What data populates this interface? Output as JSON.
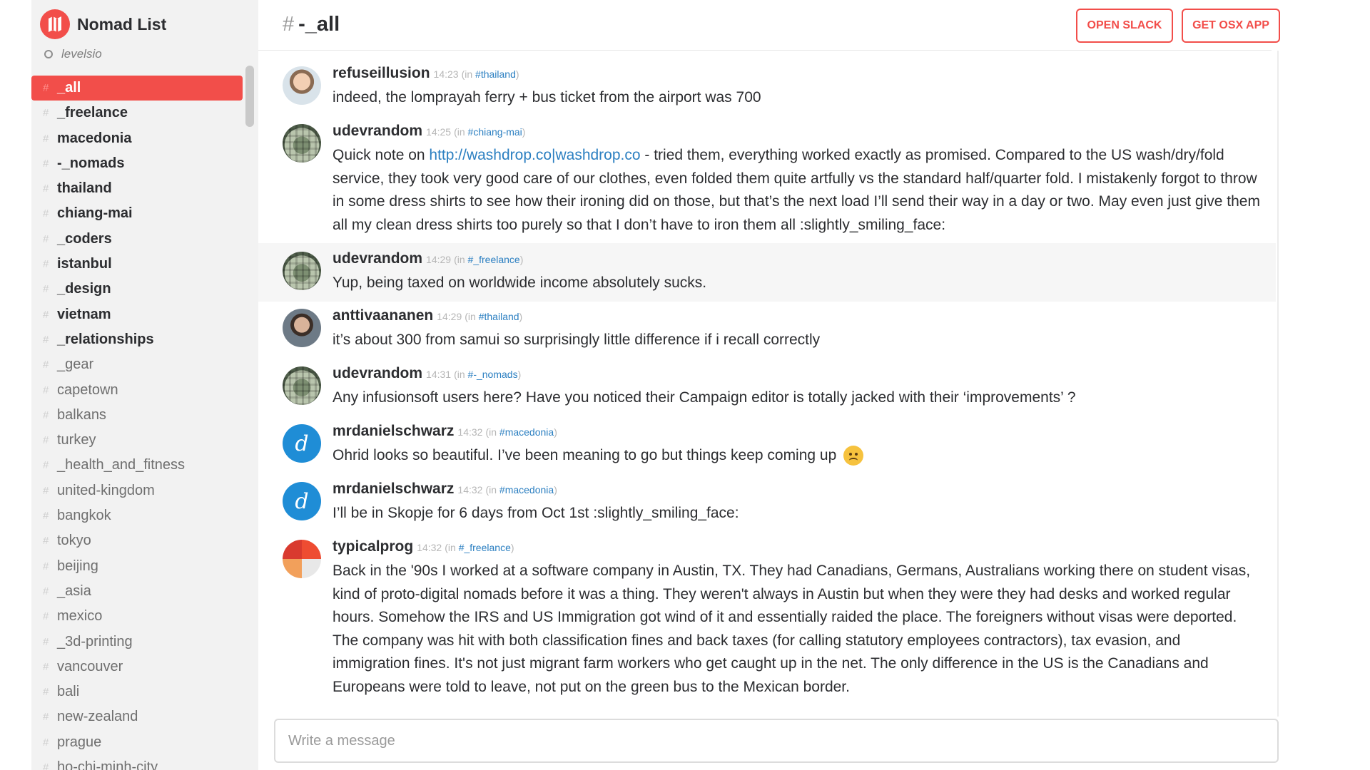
{
  "team": {
    "name": "Nomad List"
  },
  "user": {
    "name": "levelsio"
  },
  "channels": [
    {
      "label": "_all",
      "state": "active"
    },
    {
      "label": "_freelance",
      "state": "bold"
    },
    {
      "label": "macedonia",
      "state": "bold"
    },
    {
      "label": "-_nomads",
      "state": "bold"
    },
    {
      "label": "thailand",
      "state": "bold"
    },
    {
      "label": "chiang-mai",
      "state": "bold"
    },
    {
      "label": "_coders",
      "state": "bold"
    },
    {
      "label": "istanbul",
      "state": "bold"
    },
    {
      "label": "_design",
      "state": "bold"
    },
    {
      "label": "vietnam",
      "state": "bold"
    },
    {
      "label": "_relationships",
      "state": "bold"
    },
    {
      "label": "_gear",
      "state": "muted"
    },
    {
      "label": "capetown",
      "state": "muted"
    },
    {
      "label": "balkans",
      "state": "muted"
    },
    {
      "label": "turkey",
      "state": "muted"
    },
    {
      "label": "_health_and_fitness",
      "state": "muted"
    },
    {
      "label": "united-kingdom",
      "state": "muted"
    },
    {
      "label": "bangkok",
      "state": "muted"
    },
    {
      "label": "tokyo",
      "state": "muted"
    },
    {
      "label": "beijing",
      "state": "muted"
    },
    {
      "label": "_asia",
      "state": "muted"
    },
    {
      "label": "mexico",
      "state": "muted"
    },
    {
      "label": "_3d-printing",
      "state": "muted"
    },
    {
      "label": "vancouver",
      "state": "muted"
    },
    {
      "label": "bali",
      "state": "muted"
    },
    {
      "label": "new-zealand",
      "state": "muted"
    },
    {
      "label": "prague",
      "state": "muted"
    },
    {
      "label": "ho-chi-minh-city",
      "state": "muted"
    }
  ],
  "header": {
    "hash": "#",
    "channel": "-_all",
    "open_slack": "OPEN SLACK",
    "get_osx": "GET OSX APP"
  },
  "messages": [
    {
      "user": "refuseillusion",
      "time": "14:23",
      "in_prefix": "(in ",
      "channel": "#thailand",
      "in_suffix": ")",
      "text": "indeed, the lomprayah ferry + bus ticket from the airport was 700"
    },
    {
      "user": "udevrandom",
      "time": "14:25",
      "in_prefix": "(in ",
      "channel": "#chiang-mai",
      "in_suffix": ")",
      "text_before": "Quick note on ",
      "link": "http://washdrop.co|washdrop.co",
      "text_after": " - tried them, everything worked exactly as promised. Compared to the US wash/dry/fold service, they took very good care of our clothes, even folded them quite artfully vs the standard half/quarter fold. I mistakenly forgot to throw in some dress shirts to see how their ironing did on those, but that’s the next load I’ll send their way in a day or two. May even just give them all my clean dress shirts too purely so that I don’t have to iron them all :slightly_smiling_face:"
    },
    {
      "user": "udevrandom",
      "time": "14:29",
      "in_prefix": "(in ",
      "channel": "#_freelance",
      "in_suffix": ")",
      "text": "Yup, being taxed on worldwide income absolutely sucks."
    },
    {
      "user": "anttivaananen",
      "time": "14:29",
      "in_prefix": "(in ",
      "channel": "#thailand",
      "in_suffix": ")",
      "text": "it’s about 300 from samui so surprisingly little difference if i recall correctly"
    },
    {
      "user": "udevrandom",
      "time": "14:31",
      "in_prefix": "(in ",
      "channel": "#-_nomads",
      "in_suffix": ")",
      "text": "Any infusionsoft users here? Have you noticed their Campaign editor is totally jacked with their ‘improvements’ ?"
    },
    {
      "user": "mrdanielschwarz",
      "time": "14:32",
      "in_prefix": "(in ",
      "channel": "#macedonia",
      "in_suffix": ")",
      "text": "Ohrid looks so beautiful. I’ve been meaning to go but things keep coming up",
      "emoji": "disappointed-face-emoji"
    },
    {
      "user": "mrdanielschwarz",
      "time": "14:32",
      "in_prefix": "(in ",
      "channel": "#macedonia",
      "in_suffix": ")",
      "text": "I’ll be in Skopje for 6 days from Oct 1st :slightly_smiling_face:",
      "avatar_letter": "d"
    },
    {
      "user": "typicalprog",
      "time": "14:32",
      "in_prefix": "(in ",
      "channel": "#_freelance",
      "in_suffix": ")",
      "text": "Back in the '90s I worked at a software company in Austin, TX. They had Canadians, Germans, Australians working there on student visas, kind of proto-digital nomads before it was a thing. They weren't always in Austin but when they were they had desks and worked regular hours. Somehow the IRS and US Immigration got wind of it and essentially raided the place. The foreigners without visas were deported. The company was hit with both classification fines and back taxes (for calling statutory employees contractors), tax evasion, and immigration fines. It's not just migrant farm workers who get caught up in the net. The only difference in the US is the Canadians and Europeans were told to leave, not put on the green bus to the Mexican border."
    }
  ],
  "avatar_letter": "d",
  "composer": {
    "placeholder": "Write a message"
  },
  "colors": {
    "accent": "#f24e4a",
    "link": "#2b7fc1",
    "sidebar": "#f2f2f2"
  }
}
